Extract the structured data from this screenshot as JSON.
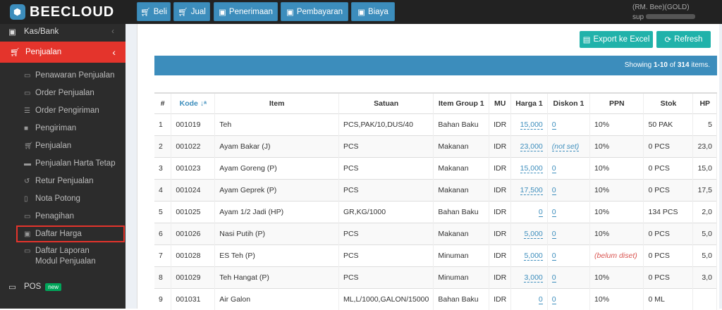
{
  "app": {
    "logo": "BEECLOUD"
  },
  "toolbar": [
    {
      "label": "Beli",
      "icon": "cart-icon"
    },
    {
      "label": "Jual",
      "icon": "cart-icon"
    },
    {
      "label": "Penerimaan",
      "icon": "money-icon"
    },
    {
      "label": "Pembayaran",
      "icon": "money-icon"
    },
    {
      "label": "Biaya",
      "icon": "money-icon"
    }
  ],
  "user": {
    "company": "(RM. Bee)(GOLD)",
    "name": "sup"
  },
  "sidebar": {
    "kas_bank": "Kas/Bank",
    "penjualan": "Penjualan",
    "items": [
      "Penawaran Penjualan",
      "Order Penjualan",
      "Order Pengiriman",
      "Pengiriman",
      "Penjualan",
      "Penjualan Harta Tetap",
      "Retur Penjualan",
      "Nota Potong",
      "Penagihan",
      "Daftar Harga",
      "Daftar Laporan Modul Penjualan"
    ],
    "pos": "POS",
    "pos_badge": "new"
  },
  "actions": {
    "export": "Export ke Excel",
    "refresh": "Refresh"
  },
  "summary": {
    "prefix": "Showing ",
    "range": "1-10",
    "of": " of ",
    "total": "314",
    "suffix": " items."
  },
  "table": {
    "headers": [
      "#",
      "Kode",
      "Item",
      "Satuan",
      "Item Group 1",
      "MU",
      "Harga 1",
      "Diskon 1",
      "PPN",
      "Stok",
      "HP"
    ],
    "rows": [
      [
        "1",
        "001019",
        "Teh",
        "PCS,PAK/10,DUS/40",
        "Bahan Baku",
        "IDR",
        "15,000",
        "0",
        "10%",
        "50 PAK",
        "5"
      ],
      [
        "2",
        "001022",
        "Ayam Bakar (J)",
        "PCS",
        "Makanan",
        "IDR",
        "23,000",
        "(not set)",
        "10%",
        "0 PCS",
        "23,0"
      ],
      [
        "3",
        "001023",
        "Ayam Goreng (P)",
        "PCS",
        "Makanan",
        "IDR",
        "15,000",
        "0",
        "10%",
        "0 PCS",
        "15,0"
      ],
      [
        "4",
        "001024",
        "Ayam Geprek (P)",
        "PCS",
        "Makanan",
        "IDR",
        "17,500",
        "0",
        "10%",
        "0 PCS",
        "17,5"
      ],
      [
        "5",
        "001025",
        "Ayam 1/2 Jadi (HP)",
        "GR,KG/1000",
        "Bahan Baku",
        "IDR",
        "0",
        "0",
        "10%",
        "134 PCS",
        "2,0"
      ],
      [
        "6",
        "001026",
        "Nasi Putih (P)",
        "PCS",
        "Makanan",
        "IDR",
        "5,000",
        "0",
        "10%",
        "0 PCS",
        "5,0"
      ],
      [
        "7",
        "001028",
        "ES Teh (P)",
        "PCS",
        "Minuman",
        "IDR",
        "5,000",
        "0",
        "(belum diset)",
        "0 PCS",
        "5,0"
      ],
      [
        "8",
        "001029",
        "Teh Hangat (P)",
        "PCS",
        "Minuman",
        "IDR",
        "3,000",
        "0",
        "10%",
        "0 PCS",
        "3,0"
      ],
      [
        "9",
        "001031",
        "Air Galon",
        "ML,L/1000,GALON/15000",
        "Bahan Baku",
        "IDR",
        "0",
        "0",
        "10%",
        "0 ML",
        ""
      ]
    ]
  }
}
